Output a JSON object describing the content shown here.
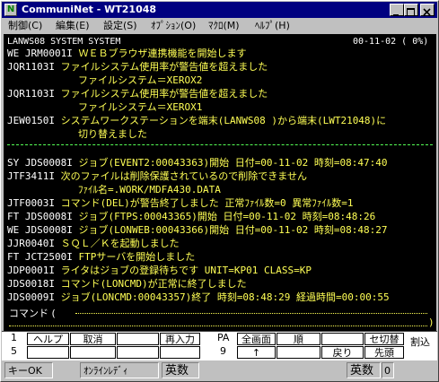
{
  "window": {
    "title": "CommuniNet - WT21048",
    "icon_label": "N",
    "buttons": [
      "minimize-icon",
      "maximize-icon",
      "close-icon"
    ]
  },
  "menu": [
    "制御(C)",
    "編集(E)",
    "設定(S)",
    "ｵﾌﾟｼｮﾝ(O)",
    "ﾏｸﾛ(M)",
    "ﾍﾙﾌﾟ(H)"
  ],
  "screen": {
    "header_left": "LANWS08  SYSTEM  SYSTEM",
    "header_right": "00-11-02 ( 0%)",
    "lines": [
      {
        "prefix": "WE JRM0001I",
        "text": "ＷＥＢブラウザ連携機能を開始します",
        "color": "g"
      },
      {
        "prefix": "   JQR1103I",
        "text": "ファイルシステム使用率が警告値を超えました",
        "color": "g"
      },
      {
        "prefix": "",
        "text": "ファイルシステム＝XEROX2",
        "color": "g"
      },
      {
        "prefix": "   JQR1103I",
        "text": "ファイルシステム使用率が警告値を超えました",
        "color": "g"
      },
      {
        "prefix": "",
        "text": "ファイルシステム＝XEROX1",
        "color": "g"
      },
      {
        "prefix": "   JEW0150I",
        "text": "システムワークステーションを端末(LANWS08 )から端末(LWT21048)に",
        "color": "g"
      },
      {
        "prefix": "",
        "text": "切り替えました",
        "color": "g"
      },
      {
        "prefix": "SY JDS0008I",
        "text": "ジョブ(EVENT2:00043363)開始  日付=00-11-02  時刻=08:47:40",
        "color": "g"
      },
      {
        "prefix": "   JTF3411I",
        "text": "次のファイルは削除保護されているので削除できません",
        "color": "g"
      },
      {
        "prefix": "",
        "text": "ﾌｧｲﾙ名=.WORK/MDFA430.DATA",
        "color": "g"
      },
      {
        "prefix": "   JTF0003I",
        "text": "コマンド(DEL)が警告終了しました  正常ﾌｧｲﾙ数=0  異常ﾌｧｲﾙ数=1",
        "color": "g"
      },
      {
        "prefix": "FT JDS0008I",
        "text": "ジョブ(FTPS:00043365)開始  日付=00-11-02  時刻=08:48:26",
        "color": "g"
      },
      {
        "prefix": "WE JDS0008I",
        "text": "ジョブ(LONWEB:00043366)開始  日付=00-11-02  時刻=08:48:27",
        "color": "g"
      },
      {
        "prefix": "   JJR0040I",
        "text": "ＳＱＬ／Ｋを起動しました",
        "color": "g"
      },
      {
        "prefix": "FT JCT2500I",
        "text": "FTPサーバを開始しました",
        "color": "g"
      },
      {
        "prefix": "   JDP0001I",
        "text": "ライタはジョブの登録待ちです UNIT=KP01 CLASS=KP",
        "color": "g"
      },
      {
        "prefix": "   JDS0018I",
        "text": "コマンド(LONCMD)が正常に終了しました",
        "color": "g"
      },
      {
        "prefix": "   JDS0009I",
        "text": "ジョブ(LONCMD:00043357)終了  時刻=08:48:29  経過時間=00:00:55",
        "color": "g"
      }
    ]
  },
  "command": {
    "label": "コマンド (",
    "close": ")"
  },
  "fkeys": {
    "row1_left_num": "1",
    "row2_left_num": "5",
    "row1_mid_label": "PA",
    "row2_mid_num": "9",
    "left_keys_row1": [
      "ヘルプ",
      "取消",
      "",
      "再入力"
    ],
    "left_keys_row2": [
      "",
      "",
      "",
      ""
    ],
    "right_keys_row1": [
      "全画面",
      "順",
      "",
      "セ切替"
    ],
    "right_keys_row2": [
      "↑",
      "",
      "戻り",
      "先頭"
    ],
    "interrupt": "割込"
  },
  "status": {
    "key_state": "キーOK",
    "mode": "ｵﾝﾗｲﾝﾚﾃﾞｨ",
    "ime": "英数",
    "ime_right": "英数",
    "counter": "0"
  }
}
